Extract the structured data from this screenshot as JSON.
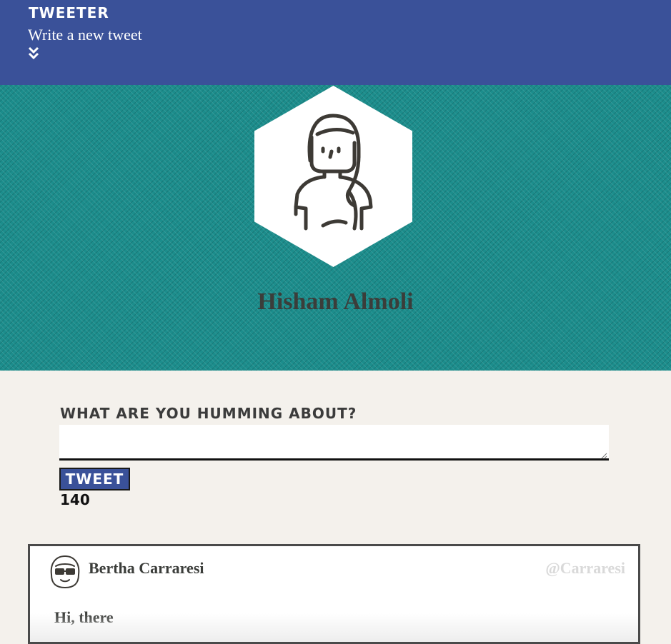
{
  "nav": {
    "brand": "Tweeter",
    "compose_link": "Write a new tweet",
    "toggle_icon": "double-chevron-down-icon"
  },
  "profile": {
    "name": "Hisham Almoli",
    "avatar_icon": "woman-avatar-icon"
  },
  "compose": {
    "label": "What are you humming about?",
    "textarea_value": "",
    "button_label": "Tweet",
    "counter": "140"
  },
  "tweets": [
    {
      "author": "Bertha Carraresi",
      "handle": "@Carraresi",
      "text": "Hi, there",
      "avatar_icon": "glasses-avatar-icon"
    }
  ],
  "colors": {
    "nav_bg": "#3a5199",
    "profile_bg": "#1c8d8c",
    "page_bg": "#f4f1ec",
    "text_dark": "#3b3d3a",
    "handle_gray": "#d9d9d9"
  }
}
